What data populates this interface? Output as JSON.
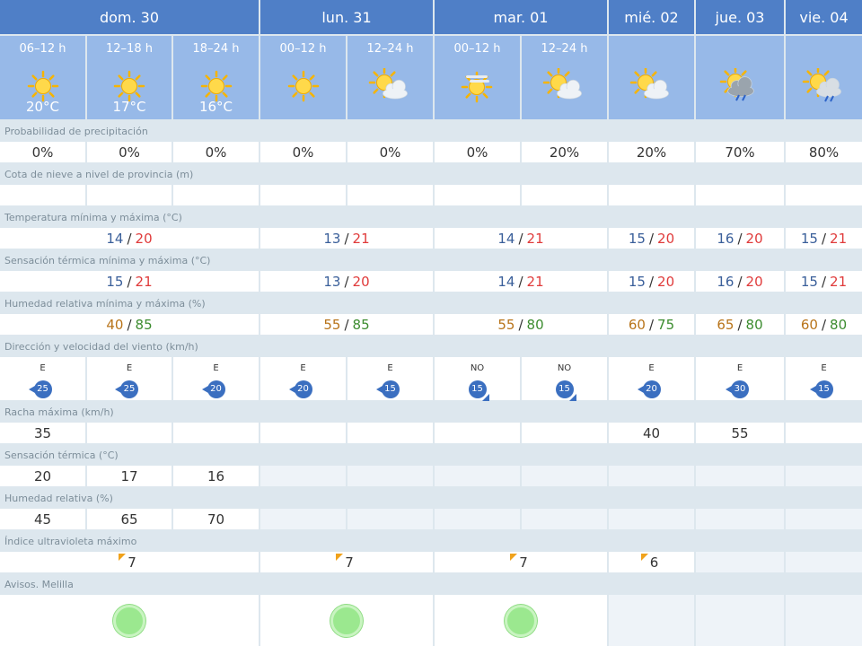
{
  "days": [
    {
      "label": "dom. 30"
    },
    {
      "label": "lun. 31"
    },
    {
      "label": "mar. 01"
    },
    {
      "label": "mié. 02"
    },
    {
      "label": "jue. 03"
    },
    {
      "label": "vie. 04"
    }
  ],
  "periods": [
    {
      "label": "06–12 h",
      "icon": "sun",
      "temp": "20°C"
    },
    {
      "label": "12–18 h",
      "icon": "sun",
      "temp": "17°C"
    },
    {
      "label": "18–24 h",
      "icon": "sun",
      "temp": "16°C"
    },
    {
      "label": "00–12 h",
      "icon": "sun",
      "temp": ""
    },
    {
      "label": "12–24 h",
      "icon": "sun-cloud",
      "temp": ""
    },
    {
      "label": "00–12 h",
      "icon": "sun-haze",
      "temp": ""
    },
    {
      "label": "12–24 h",
      "icon": "sun-cloud",
      "temp": ""
    },
    {
      "label": "",
      "icon": "sun-cloud",
      "temp": ""
    },
    {
      "label": "",
      "icon": "cloud-rain-sun",
      "temp": ""
    },
    {
      "label": "",
      "icon": "sun-cloud-rain",
      "temp": ""
    }
  ],
  "labels": {
    "precip": "Probabilidad de precipitación",
    "snow": "Cota de nieve a nivel de provincia (m)",
    "temp": "Temperatura mínima y máxima (°C)",
    "feel": "Sensación térmica mínima y máxima (°C)",
    "hum": "Humedad relativa mínima y máxima (%)",
    "wind": "Dirección y velocidad del viento (km/h)",
    "gust": "Racha máxima (km/h)",
    "feelNow": "Sensación térmica (°C)",
    "humNow": "Humedad relativa (%)",
    "uv": "Índice ultravioleta máximo",
    "avisos": "Avisos. Melilla"
  },
  "precip": [
    "0%",
    "0%",
    "0%",
    "0%",
    "0%",
    "0%",
    "20%",
    "20%",
    "70%",
    "80%"
  ],
  "snow": [
    "",
    "",
    "",
    "",
    "",
    "",
    "",
    "",
    "",
    ""
  ],
  "temp_minmax": [
    {
      "min": "14",
      "max": "20"
    },
    {
      "min": "13",
      "max": "21"
    },
    {
      "min": "14",
      "max": "21"
    },
    {
      "min": "15",
      "max": "20"
    },
    {
      "min": "16",
      "max": "20"
    },
    {
      "min": "15",
      "max": "21"
    }
  ],
  "feel_minmax": [
    {
      "min": "15",
      "max": "21"
    },
    {
      "min": "13",
      "max": "20"
    },
    {
      "min": "14",
      "max": "21"
    },
    {
      "min": "15",
      "max": "20"
    },
    {
      "min": "16",
      "max": "20"
    },
    {
      "min": "15",
      "max": "21"
    }
  ],
  "hum_minmax": [
    {
      "min": "40",
      "max": "85"
    },
    {
      "min": "55",
      "max": "85"
    },
    {
      "min": "55",
      "max": "80"
    },
    {
      "min": "60",
      "max": "75"
    },
    {
      "min": "65",
      "max": "80"
    },
    {
      "min": "60",
      "max": "80"
    }
  ],
  "wind": [
    {
      "dir": "E",
      "speed": "25"
    },
    {
      "dir": "E",
      "speed": "25"
    },
    {
      "dir": "E",
      "speed": "20"
    },
    {
      "dir": "E",
      "speed": "20"
    },
    {
      "dir": "E",
      "speed": "15"
    },
    {
      "dir": "NO",
      "speed": "15"
    },
    {
      "dir": "NO",
      "speed": "15"
    },
    {
      "dir": "E",
      "speed": "20"
    },
    {
      "dir": "E",
      "speed": "30"
    },
    {
      "dir": "E",
      "speed": "15"
    }
  ],
  "gust": [
    "35",
    "",
    "",
    "",
    "",
    "",
    "",
    "40",
    "55",
    ""
  ],
  "feel_now": [
    "20",
    "17",
    "16"
  ],
  "hum_now": [
    "45",
    "65",
    "70"
  ],
  "uv": [
    {
      "day": 0,
      "value": "7"
    },
    {
      "day": 1,
      "value": "7"
    },
    {
      "day": 2,
      "value": "7"
    },
    {
      "day": 3,
      "value": "6"
    }
  ],
  "avisos": [
    {
      "day": 0,
      "level": "green"
    },
    {
      "day": 1,
      "level": "green"
    },
    {
      "day": 2,
      "level": "green"
    }
  ],
  "colors": {
    "header_day": "#4f7fc7",
    "header_period": "#97b9e8",
    "temp_min": "#3a5f9a",
    "temp_max": "#e03b3b",
    "hum_min": "#b8741a",
    "hum_max": "#3c8c2f",
    "wind_badge": "#3b6fc0",
    "uv_flag": "#f0a21b",
    "aviso_green": "#9be88f"
  }
}
